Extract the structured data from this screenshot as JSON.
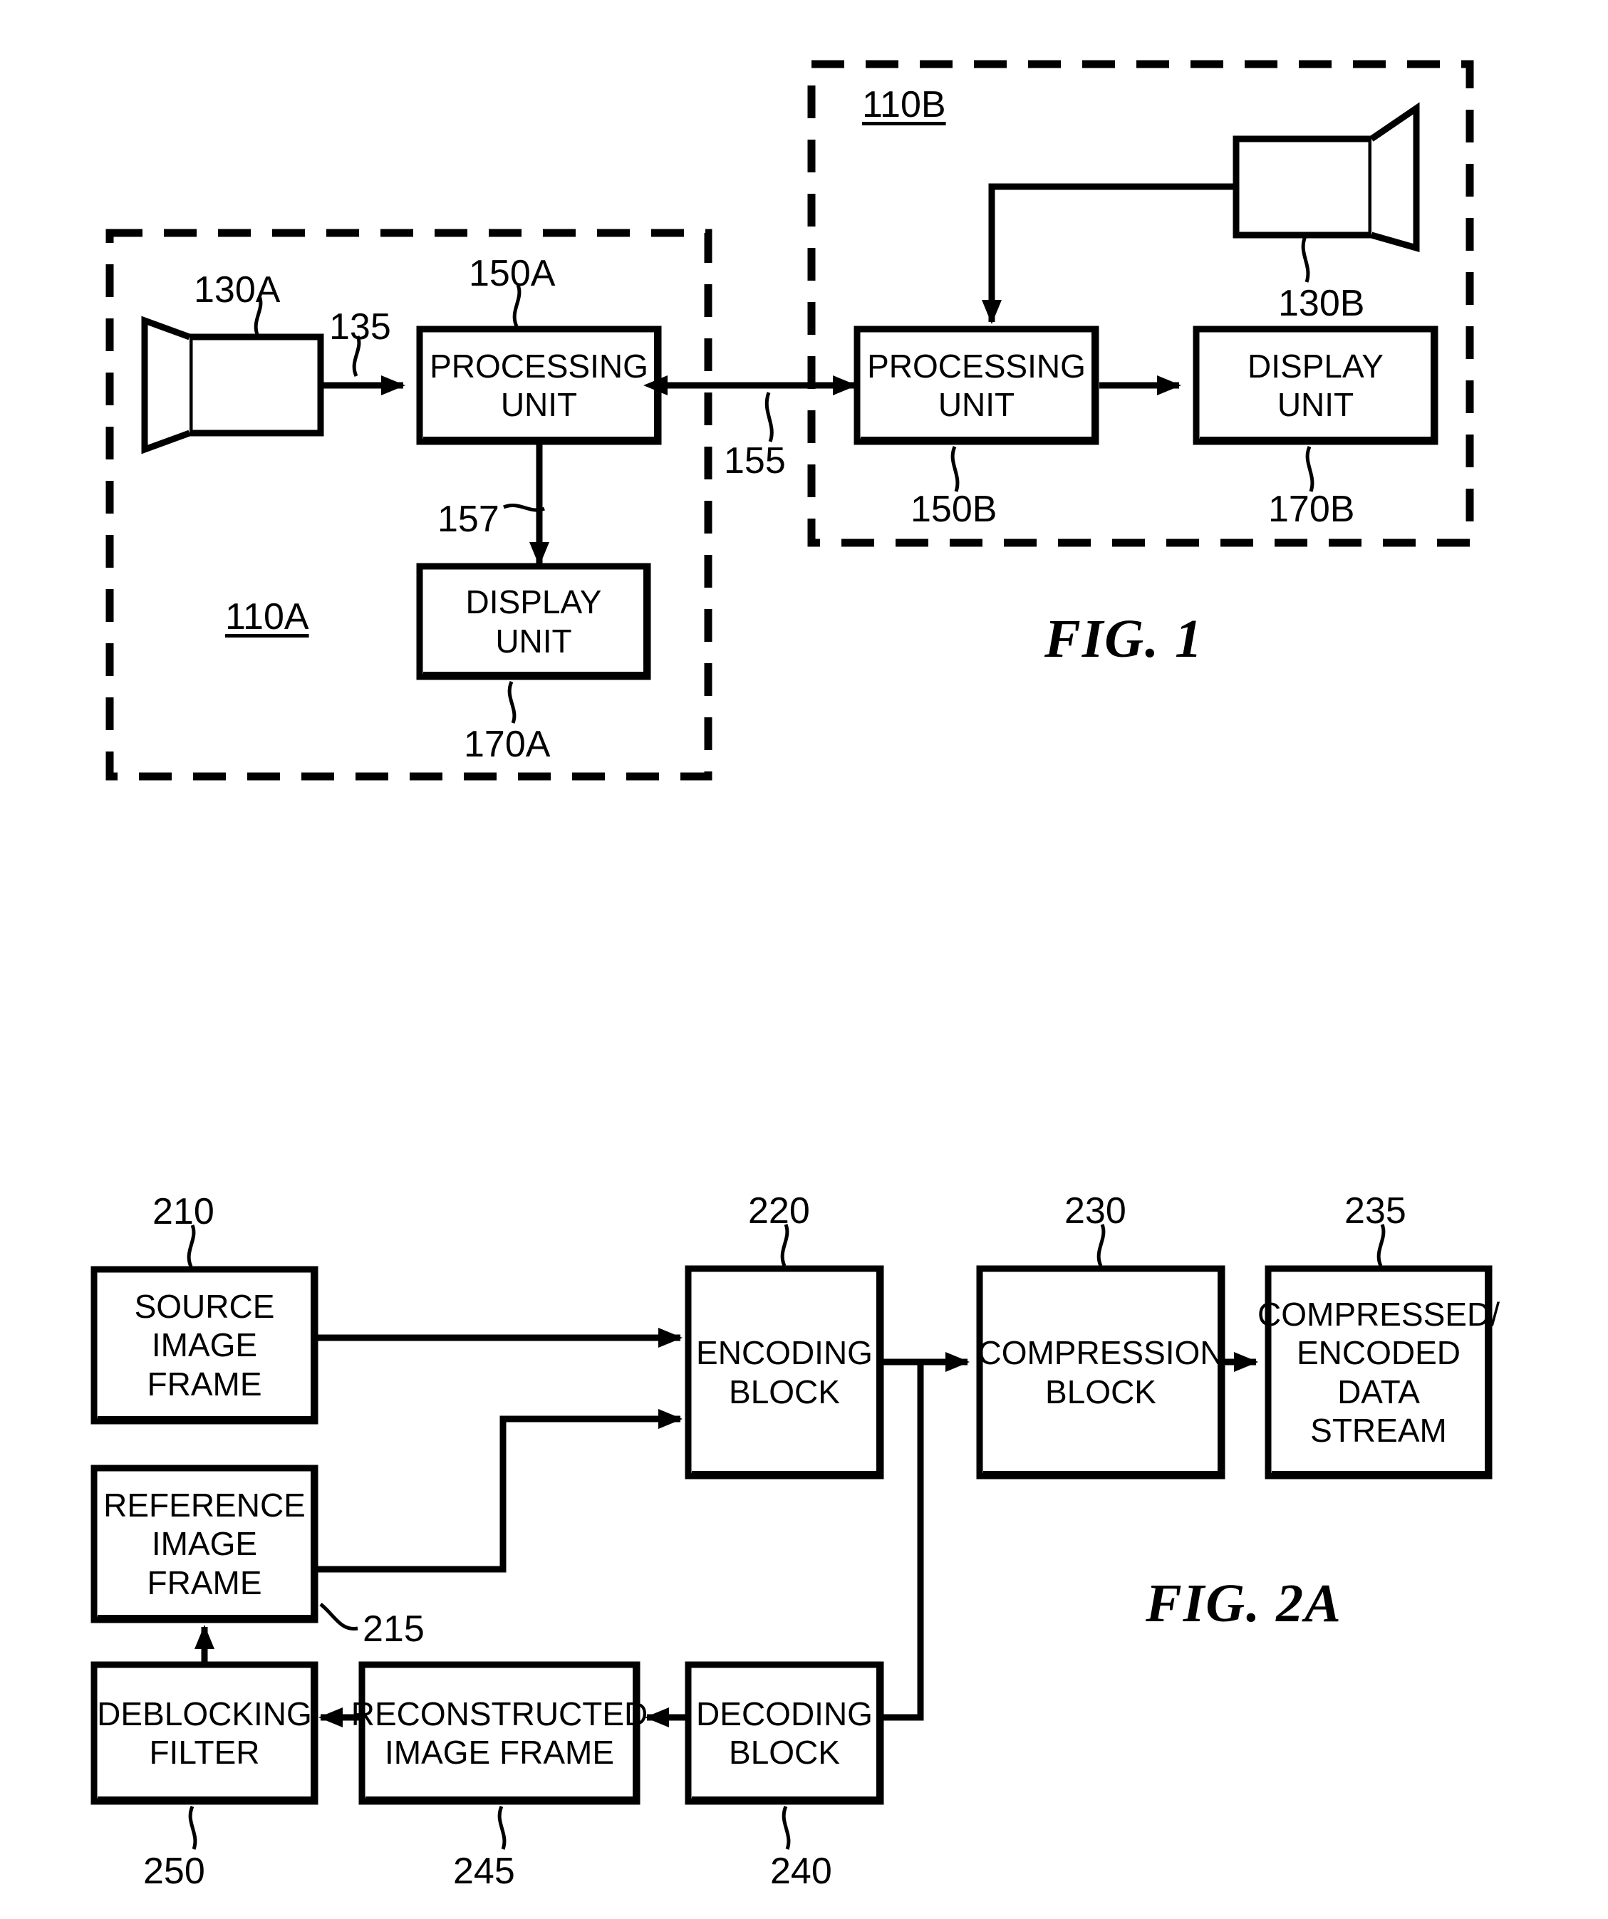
{
  "figures": [
    {
      "id": "fig1",
      "label": "FIG. 1",
      "devices": [
        {
          "ref": "110A",
          "underlined": true
        },
        {
          "ref": "110B",
          "underlined": true
        }
      ],
      "blocks": [
        {
          "name": "processing-unit-a",
          "text": "PROCESSING\nUNIT",
          "ref": "150A"
        },
        {
          "name": "display-unit-a",
          "text": "DISPLAY\nUNIT",
          "ref": "170A"
        },
        {
          "name": "processing-unit-b",
          "text": "PROCESSING\nUNIT",
          "ref": "150B"
        },
        {
          "name": "display-unit-b",
          "text": "DISPLAY\nUNIT",
          "ref": "170B"
        }
      ],
      "cameras": [
        {
          "name": "camera-a",
          "ref": "130A"
        },
        {
          "name": "camera-b",
          "ref": "130B"
        }
      ],
      "connections": [
        {
          "name": "camera-a-to-processing-a",
          "ref": "135"
        },
        {
          "name": "processing-a-to-processing-b",
          "ref": "155"
        },
        {
          "name": "processing-a-to-display-a",
          "ref": "157"
        }
      ]
    },
    {
      "id": "fig2a",
      "label": "FIG. 2A",
      "blocks": [
        {
          "name": "source-image-frame",
          "text": "SOURCE\nIMAGE\nFRAME",
          "ref": "210"
        },
        {
          "name": "reference-image-frame",
          "text": "REFERENCE\nIMAGE\nFRAME",
          "ref": "215"
        },
        {
          "name": "encoding-block",
          "text": "ENCODING\nBLOCK",
          "ref": "220"
        },
        {
          "name": "compression-block",
          "text": "COMPRESSION\nBLOCK",
          "ref": "230"
        },
        {
          "name": "compressed-encoded-data-stream",
          "text": "COMPRESSED/\nENCODED\nDATA\nSTREAM",
          "ref": "235"
        },
        {
          "name": "decoding-block",
          "text": "DECODING\nBLOCK",
          "ref": "240"
        },
        {
          "name": "reconstructed-image-frame",
          "text": "RECONSTRUCTED\nIMAGE FRAME",
          "ref": "245"
        },
        {
          "name": "deblocking-filter",
          "text": "DEBLOCKING\nFILTER",
          "ref": "250"
        }
      ]
    }
  ],
  "text": {
    "fig1_label": "FIG. 1",
    "fig2a_label": "FIG. 2A",
    "ref_110A": "110A",
    "ref_110B": "110B",
    "ref_130A": "130A",
    "ref_130B": "130B",
    "ref_135": "135",
    "ref_150A": "150A",
    "ref_150B": "150B",
    "ref_155": "155",
    "ref_157": "157",
    "ref_170A": "170A",
    "ref_170B": "170B",
    "ref_210": "210",
    "ref_215": "215",
    "ref_220": "220",
    "ref_230": "230",
    "ref_235": "235",
    "ref_240": "240",
    "ref_245": "245",
    "ref_250": "250",
    "box_processing_unit_a": "PROCESSING\nUNIT",
    "box_display_unit_a": "DISPLAY\nUNIT",
    "box_processing_unit_b": "PROCESSING\nUNIT",
    "box_display_unit_b": "DISPLAY\nUNIT",
    "box_source_image_frame": "SOURCE\nIMAGE\nFRAME",
    "box_reference_image_frame": "REFERENCE\nIMAGE\nFRAME",
    "box_encoding_block": "ENCODING\nBLOCK",
    "box_compression_block": "COMPRESSION\nBLOCK",
    "box_compressed_encoded_data_stream": "COMPRESSED/\nENCODED\nDATA\nSTREAM",
    "box_decoding_block": "DECODING\nBLOCK",
    "box_reconstructed_image_frame": "RECONSTRUCTED\nIMAGE FRAME",
    "box_deblocking_filter": "DEBLOCKING\nFILTER"
  },
  "colors": {
    "stroke": "#000000",
    "background": "#ffffff"
  }
}
